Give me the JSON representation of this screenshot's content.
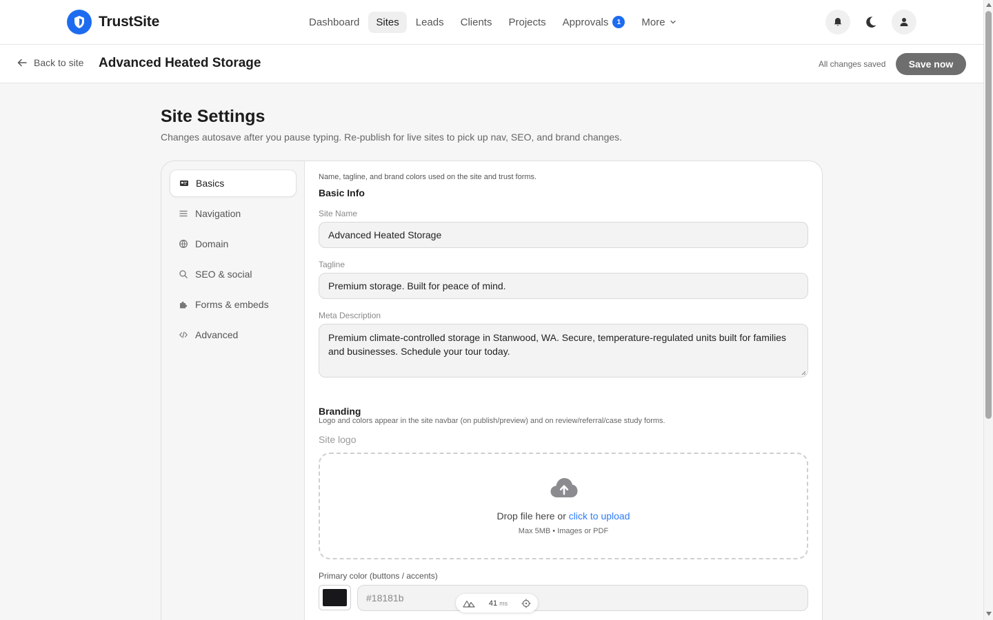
{
  "app": {
    "name": "TrustSite",
    "icons": {
      "logo": "shield-icon"
    }
  },
  "nav": {
    "items": [
      {
        "label": "Dashboard"
      },
      {
        "label": "Sites",
        "active": true
      },
      {
        "label": "Leads"
      },
      {
        "label": "Clients"
      },
      {
        "label": "Projects"
      },
      {
        "label": "Approvals",
        "badge": "1"
      },
      {
        "label": "More"
      }
    ],
    "icons": [
      "bell-icon",
      "moon-icon",
      "user-icon"
    ]
  },
  "subheader": {
    "back_label": "Back to site",
    "site_title": "Advanced Heated Storage",
    "status": "All changes saved",
    "save_label": "Save now"
  },
  "page": {
    "title": "Site Settings",
    "subtitle": "Changes autosave after you pause typing. Re-publish for live sites to pick up nav, SEO, and brand changes."
  },
  "sidebar": {
    "items": [
      {
        "label": "Basics",
        "icon": "id-card-icon",
        "active": true
      },
      {
        "label": "Navigation",
        "icon": "menu-icon"
      },
      {
        "label": "Domain",
        "icon": "globe-icon"
      },
      {
        "label": "SEO & social",
        "icon": "search-icon"
      },
      {
        "label": "Forms & embeds",
        "icon": "puzzle-icon"
      },
      {
        "label": "Advanced",
        "icon": "code-icon"
      }
    ]
  },
  "basics": {
    "intro": "Name, tagline, and brand colors used on the site and trust forms.",
    "section_title": "Basic Info",
    "site_name_label": "Site Name",
    "site_name": "Advanced Heated Storage",
    "tagline_label": "Tagline",
    "tagline": "Premium storage. Built for peace of mind.",
    "meta_label": "Meta Description",
    "meta": "Premium climate-controlled storage in Stanwood, WA. Secure, temperature-regulated units built for families and businesses. Schedule your tour today."
  },
  "branding": {
    "title": "Branding",
    "subtitle": "Logo and colors appear in the site navbar (on publish/preview) and on review/referral/case study forms.",
    "logo_label": "Site logo",
    "drop_text": "Drop file here or",
    "drop_link": "click to upload",
    "drop_hint": "Max 5MB • Images or PDF",
    "primary_label": "Primary color (buttons / accents)",
    "primary_color": "#18181b"
  },
  "devtools": {
    "ms": "41",
    "unit": "ms"
  },
  "colors": {
    "accent": "#1d6cf0",
    "link": "#2f7cf6",
    "save_button": "#6e6e6e"
  }
}
